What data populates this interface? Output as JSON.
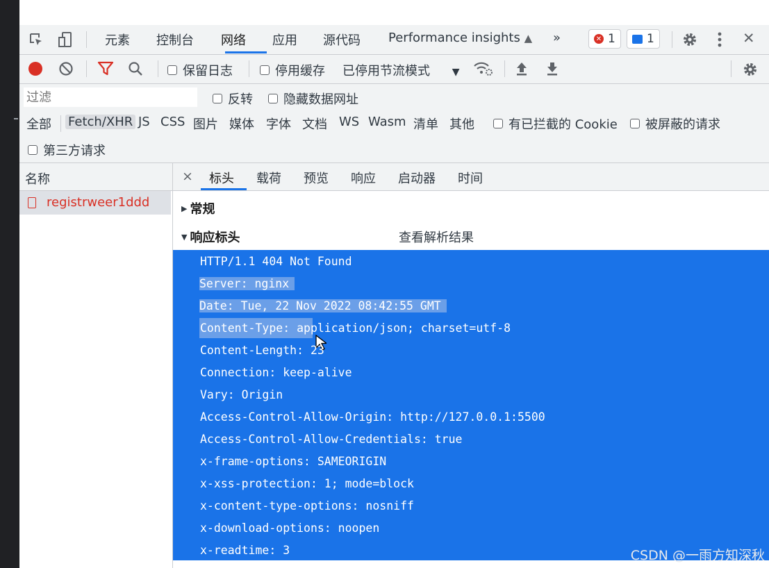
{
  "tabbar": {
    "tabs": [
      "元素",
      "控制台",
      "网络",
      "应用",
      "源代码",
      "Performance insights"
    ],
    "active": "网络",
    "more": "»",
    "error_count": "1",
    "message_count": "1",
    "close": "✕"
  },
  "toolbar": {
    "preserve_log": "保留日志",
    "disable_cache": "停用缓存",
    "throttling": "已停用节流模式"
  },
  "filters": {
    "placeholder": "过滤",
    "invert": "反转",
    "hide_data_urls": "隐藏数据网址",
    "types": [
      "全部",
      "Fetch/XHR",
      "JS",
      "CSS",
      "图片",
      "媒体",
      "字体",
      "文档",
      "WS",
      "Wasm",
      "清单",
      "其他"
    ],
    "selected_type": "Fetch/XHR",
    "blocked_cookies": "有已拦截的 Cookie",
    "blocked_requests": "被屏蔽的请求",
    "third_party": "第三方请求"
  },
  "requests": {
    "column": "名称",
    "items": [
      {
        "name": "registrweer1ddd",
        "status_color": "#d93025"
      }
    ]
  },
  "detail": {
    "close": "×",
    "tabs": [
      "标头",
      "载荷",
      "预览",
      "响应",
      "启动器",
      "时间"
    ],
    "active_tab": "标头",
    "general": "常规",
    "response_headers": "响应标头",
    "view_parsed": "查看解析结果",
    "header_lines": [
      "HTTP/1.1 404 Not Found",
      "Server: nginx",
      "Date: Tue, 22 Nov 2022 08:42:55 GMT",
      "Content-Type: application/json; charset=utf-8",
      "Content-Length: 23",
      "Connection: keep-alive",
      "Vary: Origin",
      "Access-Control-Allow-Origin: http://127.0.0.1:5500",
      "Access-Control-Allow-Credentials: true",
      "x-frame-options: SAMEORIGIN",
      "x-xss-protection: 1; mode=block",
      "x-content-type-options: nosniff",
      "x-download-options: noopen",
      "x-readtime: 3"
    ]
  },
  "watermark": "CSDN @一雨方知深秋",
  "colors": {
    "accent": "#1a73e8",
    "error": "#d93025",
    "panel": "#f1f3f4"
  }
}
